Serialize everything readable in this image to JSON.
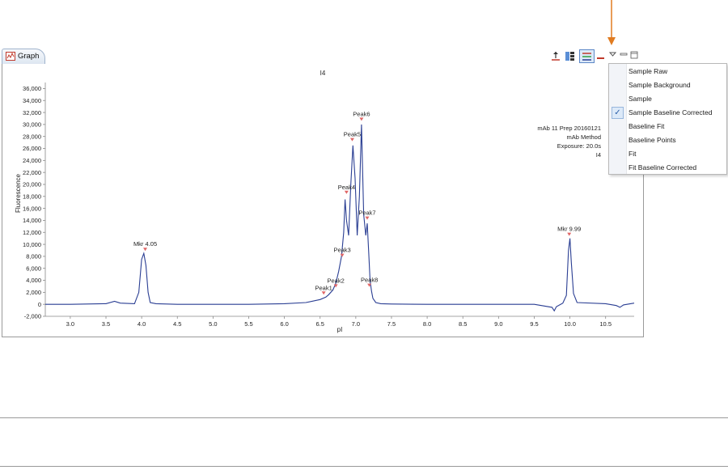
{
  "tab": {
    "label": "Graph",
    "icon": "graph-icon"
  },
  "toolbar": {
    "icons": [
      "pin-icon",
      "table-icon",
      "legend-icon",
      "minimize-icon",
      "view-menu-icon",
      "minimize-view-icon",
      "maximize-view-icon"
    ]
  },
  "plot": {
    "title": "I4",
    "info": [
      "mAb 11 Prep 20160121",
      "mAb Method",
      "Exposure: 20.0s",
      "I4"
    ],
    "colors": {
      "trace": "#2a3e93",
      "marker": "#e06666",
      "text": "#222222",
      "pointer": "#e07b20"
    }
  },
  "chart_data": {
    "type": "line",
    "title": "I4",
    "xlabel": "pI",
    "ylabel": "Fluorescence",
    "xlim": [
      2.65,
      10.9
    ],
    "ylim": [
      -2000,
      37000
    ],
    "xticks": [
      "3.0",
      "3.5",
      "4.0",
      "4.5",
      "5.0",
      "5.5",
      "6.0",
      "6.5",
      "7.0",
      "7.5",
      "8.0",
      "8.5",
      "9.0",
      "9.5",
      "10.0",
      "10.5"
    ],
    "yticks": [
      "-2,000",
      "0",
      "2,000",
      "4,000",
      "6,000",
      "8,000",
      "10,000",
      "12,000",
      "14,000",
      "16,000",
      "18,000",
      "20,000",
      "22,000",
      "24,000",
      "26,000",
      "28,000",
      "30,000",
      "32,000",
      "34,000",
      "36,000"
    ],
    "grid": false,
    "series": [
      {
        "x": [
          2.65,
          3.0,
          3.5,
          3.62,
          3.7,
          3.9,
          3.96,
          4.0,
          4.03,
          4.06,
          4.09,
          4.12,
          4.2,
          4.5,
          5.0,
          5.5,
          6.0,
          6.3,
          6.5,
          6.58,
          6.62,
          6.68,
          6.72,
          6.76,
          6.8,
          6.83,
          6.85,
          6.87,
          6.9,
          6.93,
          6.96,
          6.99,
          7.02,
          7.05,
          7.08,
          7.11,
          7.14,
          7.16,
          7.18,
          7.2,
          7.22,
          7.24,
          7.28,
          7.35,
          7.5,
          8.0,
          8.5,
          9.0,
          9.5,
          9.75,
          9.78,
          9.81,
          9.9,
          9.95,
          9.98,
          10.0,
          10.02,
          10.05,
          10.1,
          10.5,
          10.65,
          10.7,
          10.75,
          10.9
        ],
        "y": [
          0,
          0,
          100,
          500,
          200,
          100,
          2000,
          7500,
          8500,
          6500,
          2000,
          300,
          100,
          0,
          0,
          0,
          100,
          300,
          800,
          1200,
          1600,
          2400,
          3500,
          5500,
          8000,
          12000,
          17500,
          14000,
          11500,
          20000,
          26500,
          21000,
          11500,
          18000,
          30000,
          15000,
          11500,
          13500,
          9000,
          4000,
          2200,
          1000,
          300,
          100,
          50,
          0,
          0,
          0,
          0,
          -500,
          -1100,
          -400,
          200,
          1500,
          9000,
          11000,
          7000,
          1800,
          300,
          100,
          -200,
          -500,
          -100,
          200
        ]
      }
    ],
    "annotations": [
      {
        "label": "Mkr 4.05",
        "x": 4.05,
        "y": 8500
      },
      {
        "label": "Peak1",
        "x": 6.55,
        "y": 1200
      },
      {
        "label": "Peak2",
        "x": 6.72,
        "y": 2400
      },
      {
        "label": "Peak3",
        "x": 6.81,
        "y": 7500
      },
      {
        "label": "Peak4",
        "x": 6.87,
        "y": 18000
      },
      {
        "label": "Peak5",
        "x": 6.95,
        "y": 26800
      },
      {
        "label": "Peak6",
        "x": 7.08,
        "y": 30200
      },
      {
        "label": "Peak7",
        "x": 7.16,
        "y": 13700
      },
      {
        "label": "Peak8",
        "x": 7.19,
        "y": 2500
      },
      {
        "label": "Mkr 9.99",
        "x": 9.99,
        "y": 11000
      }
    ]
  },
  "menu": {
    "items": [
      {
        "label": "Sample Raw",
        "checked": false
      },
      {
        "label": "Sample Background",
        "checked": false
      },
      {
        "label": "Sample",
        "checked": false
      },
      {
        "label": "Sample Baseline Corrected",
        "checked": true
      },
      {
        "label": "Baseline Fit",
        "checked": false
      },
      {
        "label": "Baseline Points",
        "checked": false
      },
      {
        "label": "Fit",
        "checked": false
      },
      {
        "label": "Fit Baseline Corrected",
        "checked": false
      }
    ],
    "check_glyph": "✓"
  }
}
